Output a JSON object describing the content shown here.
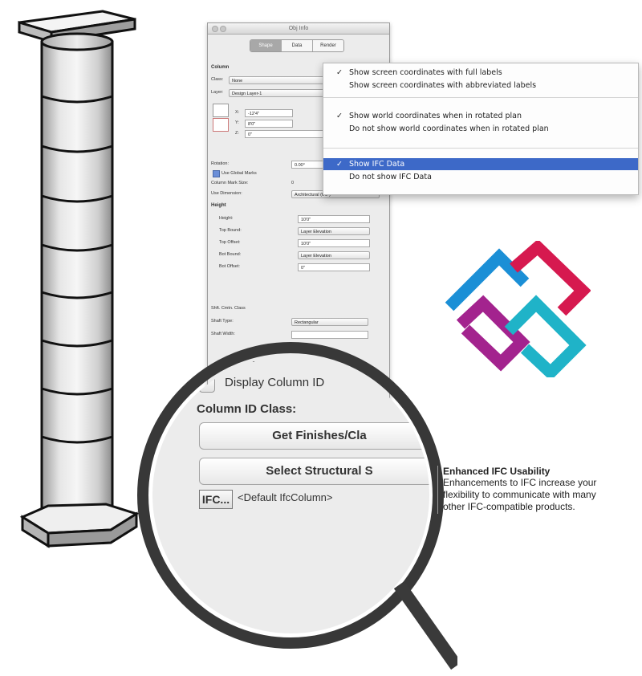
{
  "palette": {
    "title": "Obj Info",
    "tabs": [
      "Shape",
      "Data",
      "Render"
    ],
    "active_tab": "Shape",
    "section": "Column",
    "class_label": "Class:",
    "class_value": "None",
    "layer_label": "Layer:",
    "layer_value": "Design Layer-1",
    "coord_x_label": "X:",
    "coord_x_value": "-12'4\"",
    "coord_y_label": "Y:",
    "coord_y_value": "8'0\"",
    "coord_z_label": "Z:",
    "coord_z_value": "0\"",
    "rotation_label": "Rotation:",
    "rotation_value": "0.00°",
    "use_global_label": "Use Global Marks",
    "column_mark_label": "Column Mark Size:",
    "column_mark_value": "0",
    "use_dimension_label": "Use Dimension:",
    "use_dimension_value": "Architectural (6'0\")",
    "height_section": "Height",
    "height_label": "Height:",
    "height_value": "10'0\"",
    "top_bound_label": "Top Bound:",
    "top_bound_value": "Layer Elevation",
    "top_offset_label": "Top Offset:",
    "top_offset_value": "10'0\"",
    "bot_bound_label": "Bot Bound:",
    "bot_bound_value": "Layer Elevation",
    "bot_offset_label": "Bot Offset:",
    "bot_offset_value": "0\"",
    "shaft_section": "Shft. Cmtn. Class",
    "shaft_type_label": "Shaft Type:",
    "shaft_type_value": "Rectangular",
    "shaft_width_label": "Shaft Width:"
  },
  "menu": {
    "items": [
      {
        "label": "Show screen coordinates with full labels",
        "checked": true
      },
      {
        "label": "Show screen coordinates with abbreviated labels",
        "checked": false
      },
      {
        "label": "Show world coordinates when in rotated plan",
        "checked": true
      },
      {
        "label": "Do not show world coordinates when in rotated plan",
        "checked": false
      },
      {
        "label": "Show IFC Data",
        "checked": true,
        "highlighted": true
      },
      {
        "label": "Do not show IFC Data",
        "checked": false
      }
    ],
    "check_glyph": "✓"
  },
  "magnifier": {
    "partial_heading": "n ID:",
    "display_column_id_label": "Display Column ID",
    "column_id_class_label": "Column ID Class:",
    "finishes_button_label": "Get Finishes/Cla",
    "select_structural_button_label": "Select Structural S",
    "ifc_button_label": "IFC...",
    "ifc_value": "<Default IfcColumn>"
  },
  "caption": {
    "title": "Enhanced IFC Usability",
    "lines": [
      "Enhancements to IFC increase your",
      "flexibility to communicate with many",
      "other IFC-compatible products."
    ]
  },
  "colors": {
    "ifc_blue": "#1b8fd6",
    "ifc_red": "#d6194f",
    "ifc_magenta": "#a3238e",
    "ifc_cyan": "#1fb3c8",
    "menu_highlight": "#3d69c8"
  }
}
